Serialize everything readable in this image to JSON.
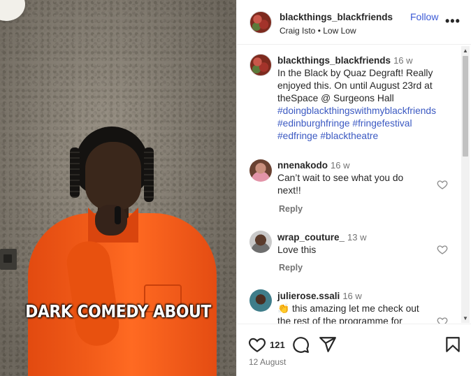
{
  "media": {
    "caption_overlay": "DARK COMEDY ABOUT"
  },
  "header": {
    "username": "blackthings_blackfriends",
    "follow_label": "Follow",
    "artist": "Craig Isto",
    "separator": "•",
    "song": "Low Low",
    "more_label": "•••"
  },
  "post": {
    "username": "blackthings_blackfriends",
    "time": "16 w",
    "caption_lines": [
      "In the Black by Quaz Degraft! Really",
      "enjoyed this. On until August 23rd at",
      "theSpace @ Surgeons Hall"
    ],
    "hashtag_lines": [
      "#doingblackthingswithmyblackfriends",
      "#edinburghfringe #fringefestival",
      "#edfringe #blacktheatre"
    ]
  },
  "comments": [
    {
      "username": "nnenakodo",
      "time": "16 w",
      "text_lines": [
        "Can’t wait to see what you do",
        "next!!"
      ],
      "reply_label": "Reply"
    },
    {
      "username": "wrap_couture_",
      "time": "13 w",
      "text_lines": [
        "Love this"
      ],
      "reply_label": "Reply"
    },
    {
      "username": "julierose.ssali",
      "time": "16 w",
      "text_lines": [
        "👏 this amazing let me check out",
        "the rest of the programme for"
      ]
    }
  ],
  "actions": {
    "likes_count": "121",
    "date": "12 August"
  },
  "icons": [
    "heart-icon",
    "comment-icon",
    "share-icon",
    "bookmark-icon",
    "more-icon"
  ],
  "colors": {
    "link": "#3b59c2",
    "follow": "#3b59d6",
    "jumpsuit": "#f05a18",
    "muted": "#737373"
  }
}
